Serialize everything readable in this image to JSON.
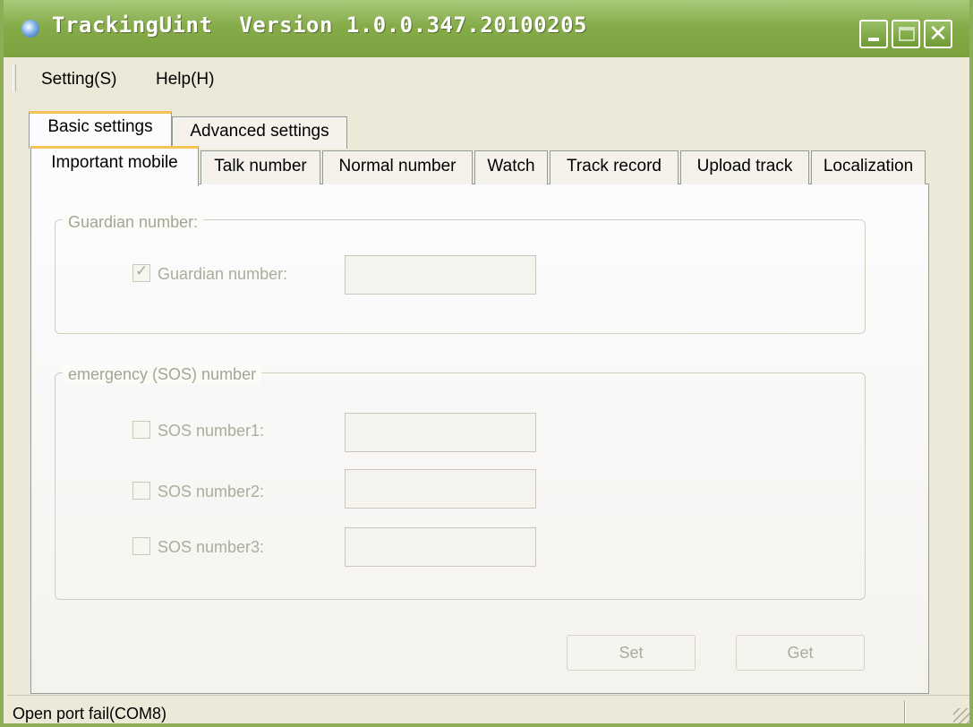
{
  "window": {
    "title": "TrackingUint  Version 1.0.0.347.20100205"
  },
  "menu": {
    "setting": "Setting(S)",
    "help": "Help(H)"
  },
  "outer_tabs": [
    {
      "label": "Basic settings",
      "selected": true
    },
    {
      "label": "Advanced settings",
      "selected": false
    }
  ],
  "inner_tabs": [
    {
      "label": "Important mobile",
      "selected": true
    },
    {
      "label": "Talk number",
      "selected": false
    },
    {
      "label": "Normal number",
      "selected": false
    },
    {
      "label": "Watch",
      "selected": false
    },
    {
      "label": "Track record",
      "selected": false
    },
    {
      "label": "Upload track",
      "selected": false
    },
    {
      "label": "Localization",
      "selected": false
    }
  ],
  "guardian_group": {
    "title": "Guardian number:",
    "checkbox_label": "Guardian number:",
    "checked": true,
    "value": ""
  },
  "sos_group": {
    "title": "emergency (SOS) number",
    "items": [
      {
        "label": "SOS number1:",
        "checked": false,
        "value": ""
      },
      {
        "label": "SOS number2:",
        "checked": false,
        "value": ""
      },
      {
        "label": "SOS number3:",
        "checked": false,
        "value": ""
      }
    ]
  },
  "buttons": {
    "set": "Set",
    "get": "Get"
  },
  "status": {
    "text": "Open port fail(COM8)"
  },
  "colors": {
    "titlebar": "#86AC4A",
    "tab_accent": "#F5C256",
    "disabled_text": "#ACAC9B"
  }
}
